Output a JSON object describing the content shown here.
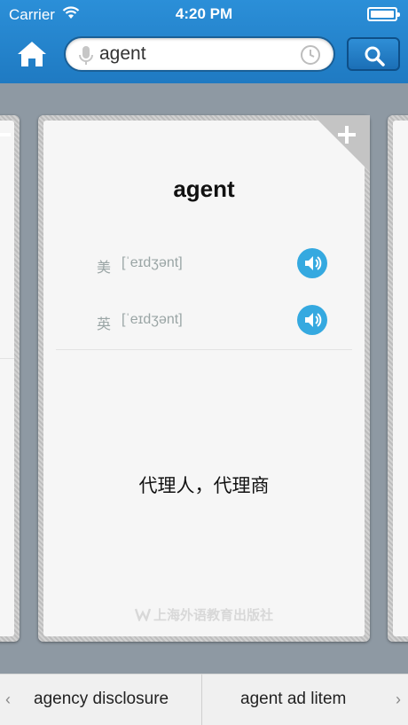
{
  "status_bar": {
    "carrier": "Carrier",
    "time": "4:20 PM"
  },
  "search": {
    "query": "agent"
  },
  "card": {
    "word": "agent",
    "us_label": "美",
    "us_ipa": "[ˈeɪdʒənt]",
    "uk_label": "英",
    "uk_ipa": "[ˈeɪdʒənt]",
    "meaning": "代理人，代理商",
    "publisher": "上海外语教育出版社"
  },
  "bottom_nav": {
    "prev_word": "agency disclosure",
    "next_word": "agent ad litem",
    "prev_chevron": "‹",
    "next_chevron": "›"
  },
  "colors": {
    "header": "#2185cf",
    "speaker": "#35a9e0",
    "background": "#8e99a3"
  },
  "icons": [
    "wifi-icon",
    "battery-icon",
    "home-icon",
    "microphone-icon",
    "clock-icon",
    "search-icon",
    "plus-icon",
    "speaker-icon",
    "publisher-logo-icon"
  ]
}
